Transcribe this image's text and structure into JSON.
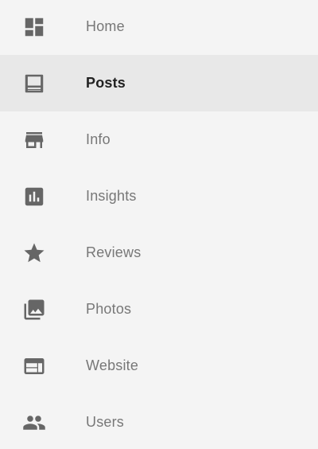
{
  "nav": {
    "items": [
      {
        "label": "Home",
        "icon": "dashboard-icon",
        "active": false
      },
      {
        "label": "Posts",
        "icon": "posts-icon",
        "active": true
      },
      {
        "label": "Info",
        "icon": "store-icon",
        "active": false
      },
      {
        "label": "Insights",
        "icon": "insights-chart-icon",
        "active": false
      },
      {
        "label": "Reviews",
        "icon": "star-icon",
        "active": false
      },
      {
        "label": "Photos",
        "icon": "photo-library-icon",
        "active": false
      },
      {
        "label": "Website",
        "icon": "web-icon",
        "active": false
      },
      {
        "label": "Users",
        "icon": "people-icon",
        "active": false
      }
    ]
  },
  "colors": {
    "background": "#f4f4f4",
    "active_background": "#e8e8e8",
    "icon": "#666666",
    "label": "#777777",
    "active_label": "#222222"
  }
}
